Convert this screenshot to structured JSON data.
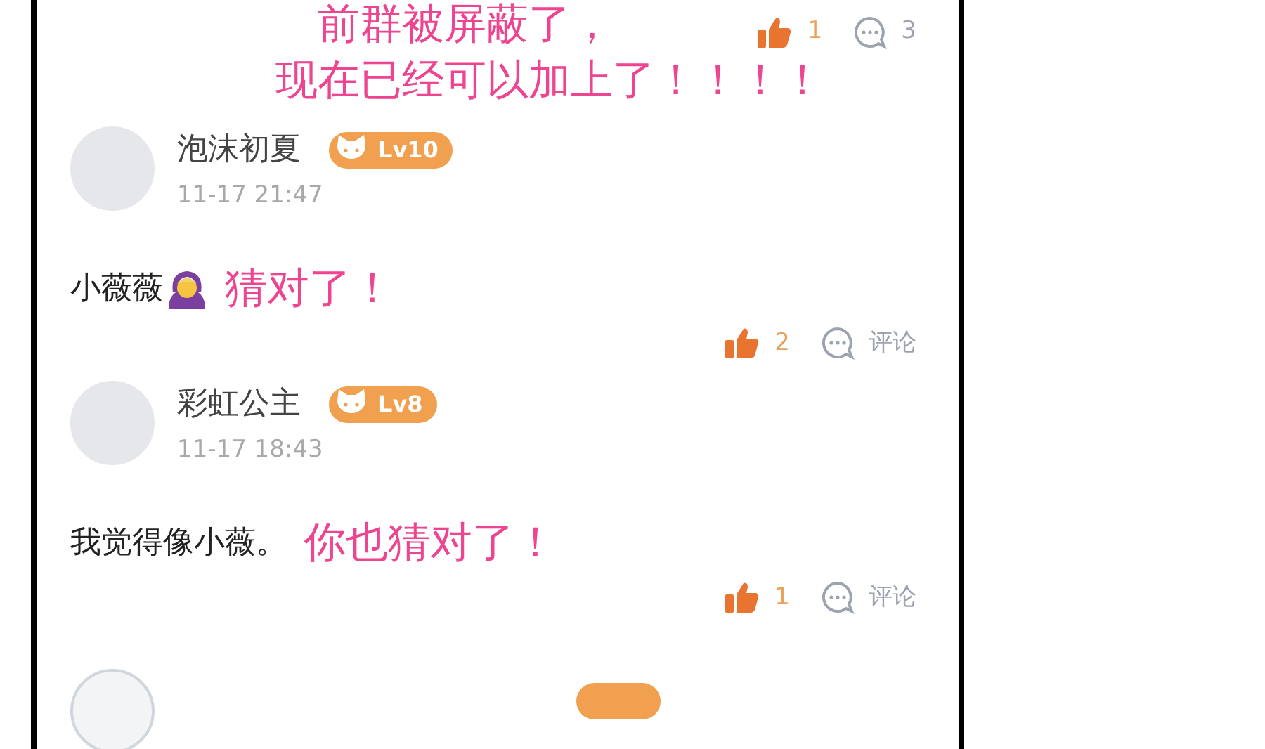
{
  "top_comment": {
    "notes": [
      "前群被屏蔽了，",
      "现在已经可以加上了！！！！"
    ],
    "likes": "1",
    "replies": "3"
  },
  "comments": [
    {
      "user": "泡沫初夏",
      "level": "Lv10",
      "time": "11-17 21:47",
      "text": "小薇薇",
      "emoji": true,
      "note": "猜对了！",
      "likes": "2",
      "reply_label": "评论"
    },
    {
      "user": "彩虹公主",
      "level": "Lv8",
      "time": "11-17 18:43",
      "text": "我觉得像小薇。",
      "emoji": false,
      "note": "你也猜对了！",
      "likes": "1",
      "reply_label": "评论"
    }
  ]
}
